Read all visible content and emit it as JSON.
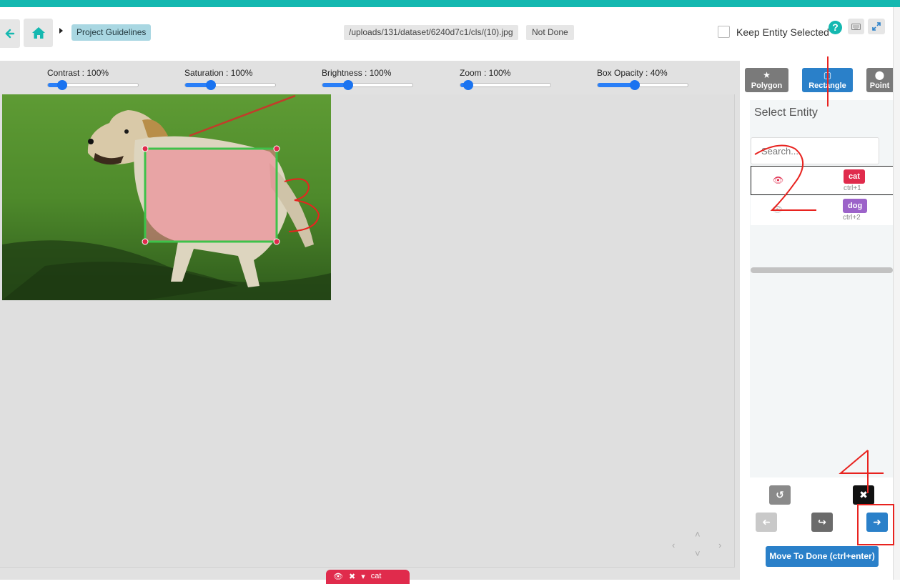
{
  "header": {
    "guidelines_label": "Project Guidelines",
    "file_path": "/uploads/131/dataset/6240d7c1/cls/(10).jpg",
    "status": "Not Done",
    "keep_entity_label": "Keep Entity Selected",
    "help_symbol": "?"
  },
  "sliders": [
    {
      "label": "Contrast : 100%",
      "value": 0.15
    },
    {
      "label": "Saturation : 100%",
      "value": 0.28
    },
    {
      "label": "Brightness : 100%",
      "value": 0.28
    },
    {
      "label": "Zoom : 100%",
      "value": 0.02
    },
    {
      "label": "Box Opacity : 40%",
      "value": 0.4
    }
  ],
  "tools": [
    {
      "label": "Polygon",
      "icon": "star-icon",
      "color": "#7a7a7a"
    },
    {
      "label": "Rectangle",
      "icon": "square-icon",
      "color": "#2a80c9"
    },
    {
      "label": "Point",
      "icon": "map-marker-icon",
      "color": "#7a7a7a"
    }
  ],
  "entity_panel": {
    "title": "Select Entity",
    "search_placeholder": "Search...",
    "entities": [
      {
        "name": "cat",
        "shortcut": "ctrl+1",
        "color": "#e02b4c"
      },
      {
        "name": "dog",
        "shortcut": "ctrl+2",
        "color": "#9c63c9"
      }
    ]
  },
  "actions": {
    "done_label": "Move To Done (ctrl+enter)"
  },
  "bottom_toolbar": {
    "label": "cat"
  },
  "colors": {
    "accent": "#14b8b0",
    "primary": "#2a80c9",
    "annotation_box": "#3ec24a",
    "annotation_fill": "#f07b8f",
    "handle": "#e02b4c",
    "marker_red": "#e8231f"
  }
}
